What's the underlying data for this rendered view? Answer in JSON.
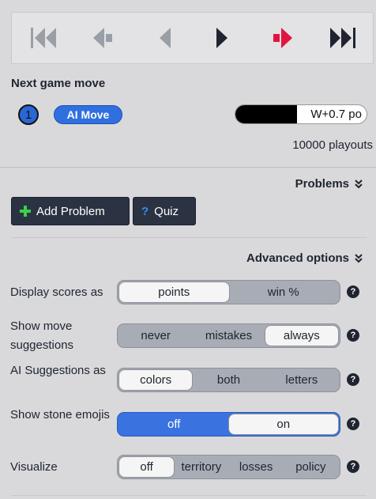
{
  "nav": {
    "buttons": [
      {
        "name": "first-move-icon"
      },
      {
        "name": "back-ten-icon"
      },
      {
        "name": "back-one-icon"
      },
      {
        "name": "forward-one-icon"
      },
      {
        "name": "forward-ten-icon"
      },
      {
        "name": "last-move-icon"
      }
    ]
  },
  "next_move": {
    "title": "Next game move",
    "move_number": "1",
    "ai_button": "AI Move",
    "score_text": "W+0.7 po",
    "black_fraction": 0.47,
    "playouts": "10000 playouts"
  },
  "problems": {
    "title": "Problems",
    "add_problem": "Add Problem",
    "quiz": "Quiz"
  },
  "advanced": {
    "title": "Advanced options",
    "rows": [
      {
        "label": "Display scores as",
        "options": [
          "points",
          "win %"
        ],
        "selected": 0
      },
      {
        "label": "Show move suggestions",
        "options": [
          "never",
          "mistakes",
          "always"
        ],
        "selected": 2
      },
      {
        "label": "AI Suggestions as",
        "options": [
          "colors",
          "both",
          "letters"
        ],
        "selected": 0
      },
      {
        "label": "Show stone emojis",
        "options": [
          "off",
          "on"
        ],
        "selected": 1
      },
      {
        "label": "Visualize",
        "options": [
          "off",
          "territory",
          "losses",
          "policy"
        ],
        "selected": 0
      }
    ],
    "help_symbol": "?"
  },
  "colors": {
    "accent_red": "#e0163f",
    "nav_dark": "#2b3342",
    "blue": "#3a73df"
  }
}
